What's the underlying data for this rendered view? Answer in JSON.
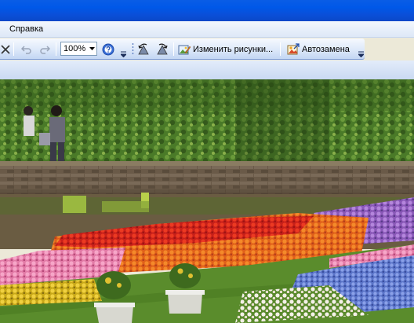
{
  "menu": {
    "help_label": "Справка"
  },
  "toolbar": {
    "zoom_value": "100%",
    "edit_picture_label": "Изменить рисунки...",
    "autocorrect_label": "Автозамена"
  },
  "icons": [
    "close-icon",
    "undo-icon",
    "redo-icon",
    "dropdown-arrow-icon",
    "help-icon",
    "overflow-chevron-icon",
    "rotate-left-icon",
    "rotate-right-icon",
    "edit-picture-icon",
    "autocorrect-icon"
  ],
  "photo": {
    "subject": "garden-flowerbed",
    "colors": {
      "tulip_red": "#d8281c",
      "tulip_orange": "#e8661a",
      "tulip_pink": "#e87aa8",
      "tulip_purple": "#8a5ab8",
      "tulip_blue": "#5a78d0",
      "hedge": "#4e7a2a",
      "lawn": "#5a8c2c"
    }
  }
}
